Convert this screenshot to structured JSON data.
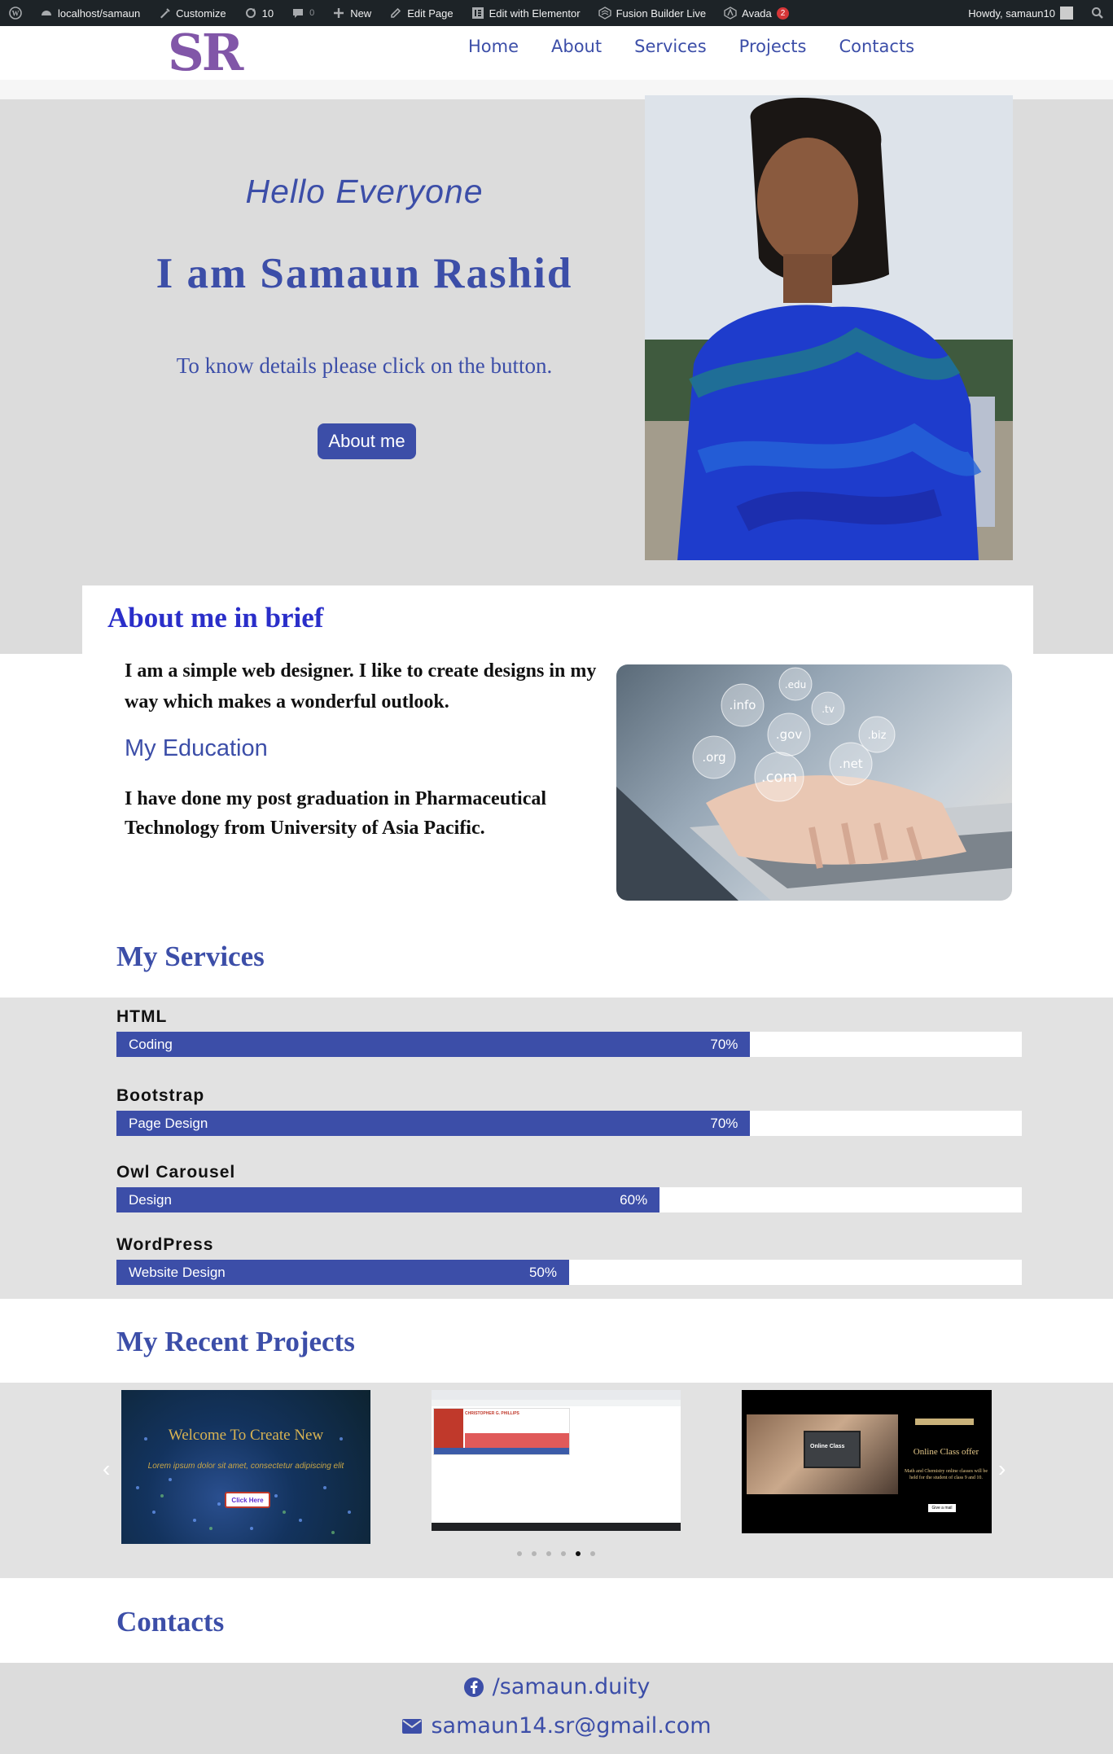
{
  "admin_bar": {
    "site": "localhost/samaun",
    "customize": "Customize",
    "updates": "10",
    "comments": "0",
    "new": "New",
    "edit_page": "Edit Page",
    "elementor": "Edit with Elementor",
    "fusion": "Fusion Builder Live",
    "avada": "Avada",
    "avada_badge": "2",
    "howdy": "Howdy, samaun10"
  },
  "header": {
    "logo": "SR",
    "nav": [
      "Home",
      "About",
      "Services",
      "Projects",
      "Contacts"
    ]
  },
  "hero": {
    "greeting": "Hello Everyone",
    "name": "I am Samaun Rashid",
    "description": "To know details please click on the button.",
    "button": "About me"
  },
  "about": {
    "title": "About me in brief",
    "text": "I am a simple web designer. I like to create designs in my way which makes a wonderful outlook.",
    "education_title": "My Education",
    "education_text": "I have done my post graduation in Pharmaceutical Technology from University of Asia Pacific.",
    "bubbles": [
      ".info",
      ".edu",
      ".tv",
      ".gov",
      ".biz",
      ".org",
      ".com",
      ".net"
    ]
  },
  "services": {
    "title": "My Services",
    "skills": [
      {
        "name": "HTML",
        "label": "Coding",
        "percent_text": "70%",
        "percent": 70
      },
      {
        "name": "Bootstrap",
        "label": "Page Design",
        "percent_text": "70%",
        "percent": 70
      },
      {
        "name": "Owl Carousel",
        "label": "Design",
        "percent_text": "60%",
        "percent": 60
      },
      {
        "name": "WordPress",
        "label": "Website Design",
        "percent_text": "50%",
        "percent": 50
      }
    ]
  },
  "projects": {
    "title": "My Recent Projects",
    "p1": {
      "heading": "Welcome To  Create New",
      "sub": "Lorem ipsum dolor sit amet, consectetur adipiscing elit",
      "button": "Click Here"
    },
    "p2": {
      "heading": "CHRISTOPHER G. PHILLIPS"
    },
    "p3": {
      "tag": "Online Class",
      "heading": "Online Class offer",
      "body": "Math and Chemistry online classes will be held for the student of class 9 and 10.",
      "button": "Give a mail"
    },
    "dots_count": 6,
    "active_dot": 4
  },
  "contacts": {
    "title": "Contacts",
    "facebook": "/samaun.duity",
    "email": "samaun14.sr@gmail.com"
  },
  "colors": {
    "accent": "#3c4ea8",
    "about_title": "#2a2ec9",
    "logo": "#8156a8",
    "admin_bar": "#1d2327"
  }
}
